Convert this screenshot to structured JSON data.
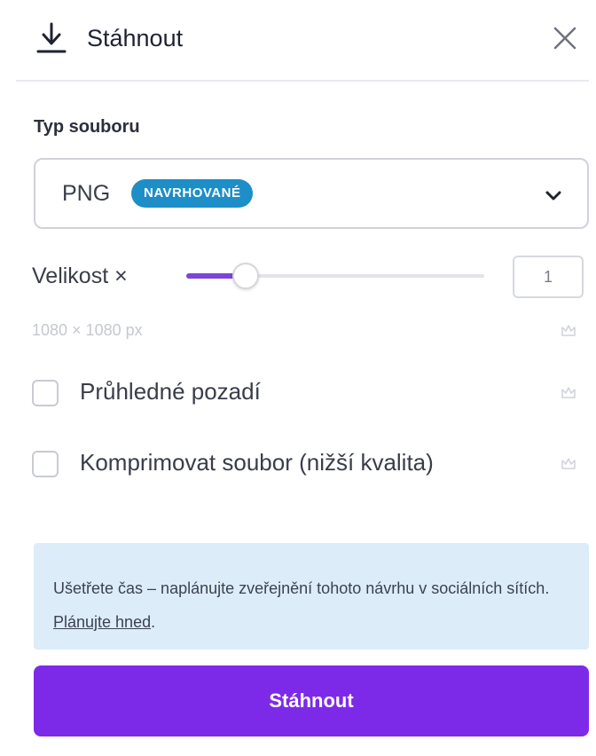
{
  "header": {
    "title": "Stáhnout",
    "icon": "download-icon",
    "close_icon": "close-icon"
  },
  "file_type": {
    "label": "Typ souboru",
    "selected": "PNG",
    "badge": "NAVRHOVANÉ",
    "badge_color": "#1d8ec8"
  },
  "size": {
    "label": "Velikost ×",
    "value": "1",
    "slider_fraction": 0.2,
    "dimensions": "1080 × 1080 px"
  },
  "options": [
    {
      "label": "Průhledné pozadí",
      "checked": false
    },
    {
      "label": "Komprimovat soubor (nižší kvalita)",
      "checked": false
    }
  ],
  "info": {
    "text": "Ušetřete čas – naplánujte zveřejnění tohoto návrhu v sociálních sítích. ",
    "link": "Plánujte hned",
    "suffix": "."
  },
  "download_button": {
    "label": "Stáhnout",
    "color": "#7d2ae8"
  },
  "colors": {
    "accent": "#7d2ae8",
    "slider_fill": "#7b46d6",
    "info_background": "#dcedf9"
  }
}
